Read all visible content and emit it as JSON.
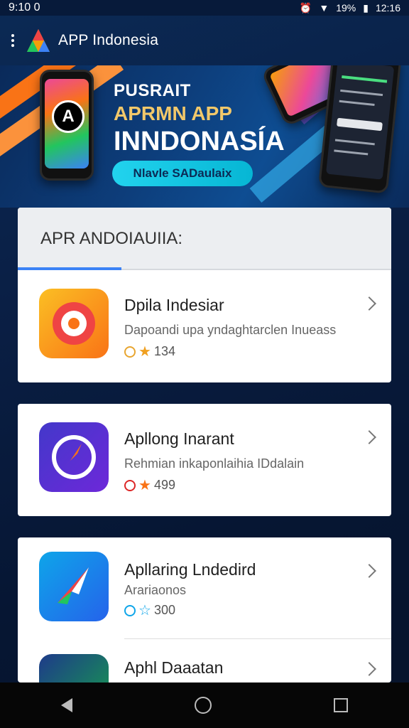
{
  "status_bar": {
    "time": "9:10 0",
    "battery": "19%",
    "clock": "12:16"
  },
  "app_bar": {
    "title": "APP Indonesia"
  },
  "banner": {
    "line1": "PUSRAIT",
    "line2": "APRMN APP",
    "line3": "INNDONASÍA",
    "button": "Nlavle SADaulaix"
  },
  "section": {
    "title": "APR ANDOIAUIIA:"
  },
  "apps": [
    {
      "name": "Dpila Indesiаr",
      "desc": "Dapoandi upa yndaghtarclen Inueass",
      "rating": "134"
    },
    {
      "name": "Apllong Inarant",
      "desc": "Rehmian inkaponlaihia IDdalain",
      "rating": "499"
    },
    {
      "name": "Apllaring Lndedird",
      "desc": "Arariaonos",
      "rating": "300"
    },
    {
      "name": "Aphl Daaatan",
      "desc": "",
      "rating": ""
    }
  ],
  "colors": {
    "accent": "#3b82f6",
    "pill": "#06b6d4",
    "gold": "#f2c86a"
  },
  "icons": {
    "back": "back-triangle-icon",
    "home": "home-circle-icon",
    "recents": "recents-square-icon"
  }
}
